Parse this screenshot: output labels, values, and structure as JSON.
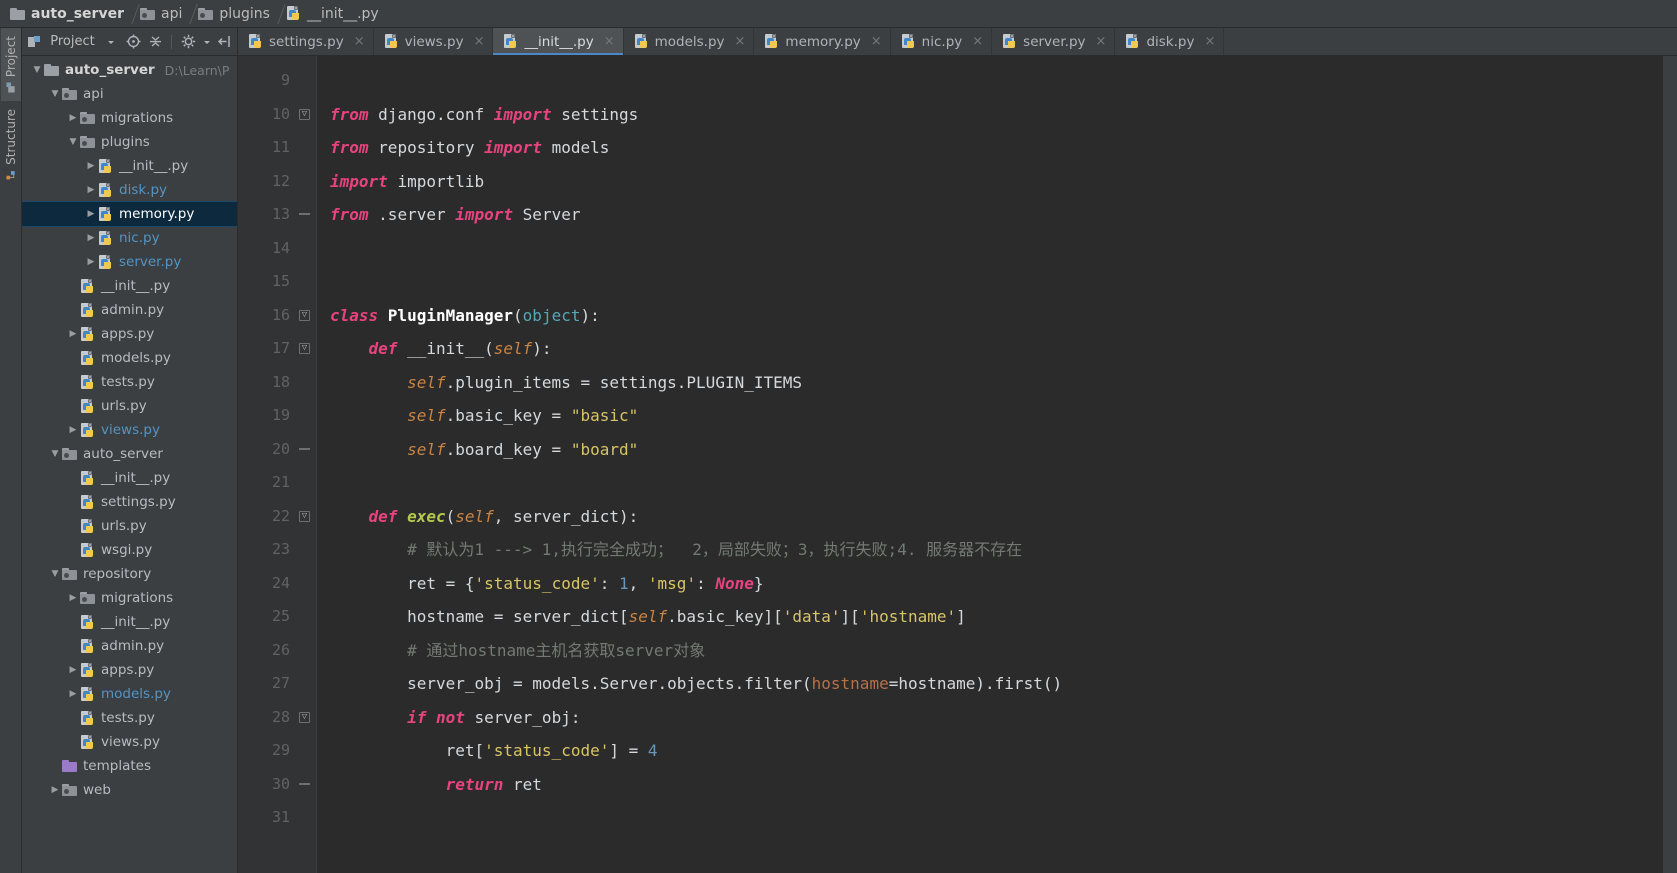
{
  "window": {
    "accent": "#4a88c7",
    "bg": "#3c3f41",
    "editor_bg": "#2b2b2b"
  },
  "breadcrumb": [
    {
      "label": "auto_server",
      "icon": "folder-icon",
      "bold": true
    },
    {
      "label": "api",
      "icon": "source-folder-icon",
      "bold": false
    },
    {
      "label": "plugins",
      "icon": "source-folder-icon",
      "bold": false
    },
    {
      "label": "__init__.py",
      "icon": "python-file-icon",
      "bold": false
    }
  ],
  "project_panel": {
    "title": "Project",
    "icons": {
      "panel": "project-panel-icon",
      "dropdown": "chevron-down-icon",
      "locate": "target-icon",
      "collapse": "collapse-all-icon",
      "settings": "gear-icon",
      "settings_arrow": "chevron-down-icon",
      "hide": "hide-panel-icon"
    },
    "tree": [
      {
        "depth": 0,
        "arrow": "down",
        "icon": "folder-icon",
        "label": "auto_server",
        "bold": true,
        "path": "D:\\Learn\\P",
        "selected": false,
        "color": "default"
      },
      {
        "depth": 1,
        "arrow": "down",
        "icon": "source-folder-icon",
        "label": "api",
        "bold": false,
        "path": "",
        "selected": false,
        "color": "default"
      },
      {
        "depth": 2,
        "arrow": "right",
        "icon": "source-folder-icon",
        "label": "migrations",
        "bold": false,
        "path": "",
        "selected": false,
        "color": "default"
      },
      {
        "depth": 2,
        "arrow": "down",
        "icon": "source-folder-icon",
        "label": "plugins",
        "bold": false,
        "path": "",
        "selected": false,
        "color": "default"
      },
      {
        "depth": 3,
        "arrow": "right",
        "icon": "python-file-icon",
        "label": "__init__.py",
        "bold": false,
        "path": "",
        "selected": false,
        "color": "default"
      },
      {
        "depth": 3,
        "arrow": "right",
        "icon": "python-file-icon",
        "label": "disk.py",
        "bold": false,
        "path": "",
        "selected": false,
        "color": "teal"
      },
      {
        "depth": 3,
        "arrow": "right",
        "icon": "python-file-icon",
        "label": "memory.py",
        "bold": false,
        "path": "",
        "selected": true,
        "color": "default"
      },
      {
        "depth": 3,
        "arrow": "right",
        "icon": "python-file-icon",
        "label": "nic.py",
        "bold": false,
        "path": "",
        "selected": false,
        "color": "teal"
      },
      {
        "depth": 3,
        "arrow": "right",
        "icon": "python-file-icon",
        "label": "server.py",
        "bold": false,
        "path": "",
        "selected": false,
        "color": "teal"
      },
      {
        "depth": 2,
        "arrow": "none",
        "icon": "python-file-icon",
        "label": "__init__.py",
        "bold": false,
        "path": "",
        "selected": false,
        "color": "default"
      },
      {
        "depth": 2,
        "arrow": "none",
        "icon": "python-file-icon",
        "label": "admin.py",
        "bold": false,
        "path": "",
        "selected": false,
        "color": "default"
      },
      {
        "depth": 2,
        "arrow": "right",
        "icon": "python-file-icon",
        "label": "apps.py",
        "bold": false,
        "path": "",
        "selected": false,
        "color": "default"
      },
      {
        "depth": 2,
        "arrow": "none",
        "icon": "python-file-icon",
        "label": "models.py",
        "bold": false,
        "path": "",
        "selected": false,
        "color": "default"
      },
      {
        "depth": 2,
        "arrow": "none",
        "icon": "python-file-icon",
        "label": "tests.py",
        "bold": false,
        "path": "",
        "selected": false,
        "color": "default"
      },
      {
        "depth": 2,
        "arrow": "none",
        "icon": "python-file-icon",
        "label": "urls.py",
        "bold": false,
        "path": "",
        "selected": false,
        "color": "default"
      },
      {
        "depth": 2,
        "arrow": "right",
        "icon": "python-file-icon",
        "label": "views.py",
        "bold": false,
        "path": "",
        "selected": false,
        "color": "teal"
      },
      {
        "depth": 1,
        "arrow": "down",
        "icon": "source-folder-icon",
        "label": "auto_server",
        "bold": false,
        "path": "",
        "selected": false,
        "color": "default"
      },
      {
        "depth": 2,
        "arrow": "none",
        "icon": "python-file-icon",
        "label": "__init__.py",
        "bold": false,
        "path": "",
        "selected": false,
        "color": "default"
      },
      {
        "depth": 2,
        "arrow": "none",
        "icon": "python-file-icon",
        "label": "settings.py",
        "bold": false,
        "path": "",
        "selected": false,
        "color": "default"
      },
      {
        "depth": 2,
        "arrow": "none",
        "icon": "python-file-icon",
        "label": "urls.py",
        "bold": false,
        "path": "",
        "selected": false,
        "color": "default"
      },
      {
        "depth": 2,
        "arrow": "none",
        "icon": "python-file-icon",
        "label": "wsgi.py",
        "bold": false,
        "path": "",
        "selected": false,
        "color": "default"
      },
      {
        "depth": 1,
        "arrow": "down",
        "icon": "source-folder-icon",
        "label": "repository",
        "bold": false,
        "path": "",
        "selected": false,
        "color": "default"
      },
      {
        "depth": 2,
        "arrow": "right",
        "icon": "source-folder-icon",
        "label": "migrations",
        "bold": false,
        "path": "",
        "selected": false,
        "color": "default"
      },
      {
        "depth": 2,
        "arrow": "none",
        "icon": "python-file-icon",
        "label": "__init__.py",
        "bold": false,
        "path": "",
        "selected": false,
        "color": "default"
      },
      {
        "depth": 2,
        "arrow": "none",
        "icon": "python-file-icon",
        "label": "admin.py",
        "bold": false,
        "path": "",
        "selected": false,
        "color": "default"
      },
      {
        "depth": 2,
        "arrow": "right",
        "icon": "python-file-icon",
        "label": "apps.py",
        "bold": false,
        "path": "",
        "selected": false,
        "color": "default"
      },
      {
        "depth": 2,
        "arrow": "right",
        "icon": "python-file-icon",
        "label": "models.py",
        "bold": false,
        "path": "",
        "selected": false,
        "color": "teal"
      },
      {
        "depth": 2,
        "arrow": "none",
        "icon": "python-file-icon",
        "label": "tests.py",
        "bold": false,
        "path": "",
        "selected": false,
        "color": "default"
      },
      {
        "depth": 2,
        "arrow": "none",
        "icon": "python-file-icon",
        "label": "views.py",
        "bold": false,
        "path": "",
        "selected": false,
        "color": "default"
      },
      {
        "depth": 1,
        "arrow": "none",
        "icon": "templates-folder-icon",
        "label": "templates",
        "bold": false,
        "path": "",
        "selected": false,
        "color": "default"
      },
      {
        "depth": 1,
        "arrow": "right",
        "icon": "source-folder-icon",
        "label": "web",
        "bold": false,
        "path": "",
        "selected": false,
        "color": "default"
      }
    ]
  },
  "tool_windows": [
    {
      "label": "Project",
      "icon": "project-icon",
      "selected": true
    },
    {
      "label": "Structure",
      "icon": "structure-icon",
      "selected": false
    }
  ],
  "editor_tabs": [
    {
      "label": "settings.py",
      "icon": "python-file-icon",
      "active": false,
      "close": "×"
    },
    {
      "label": "views.py",
      "icon": "python-file-icon",
      "active": false,
      "close": "×"
    },
    {
      "label": "__init__.py",
      "icon": "python-file-icon",
      "active": true,
      "close": "×"
    },
    {
      "label": "models.py",
      "icon": "python-file-icon",
      "active": false,
      "close": "×"
    },
    {
      "label": "memory.py",
      "icon": "python-file-icon",
      "active": false,
      "close": "×"
    },
    {
      "label": "nic.py",
      "icon": "python-file-icon",
      "active": false,
      "close": "×"
    },
    {
      "label": "server.py",
      "icon": "python-file-icon",
      "active": false,
      "close": "×"
    },
    {
      "label": "disk.py",
      "icon": "python-file-icon",
      "active": false,
      "close": "×"
    }
  ],
  "code": {
    "first_line_number": 9,
    "lines": [
      {
        "n": 9,
        "fold": "none",
        "tokens": []
      },
      {
        "n": 10,
        "fold": "start",
        "tokens": [
          {
            "t": "from ",
            "c": "kwpy"
          },
          {
            "t": "django.conf ",
            "c": "plain"
          },
          {
            "t": "import ",
            "c": "kwpy"
          },
          {
            "t": "settings",
            "c": "plain"
          }
        ]
      },
      {
        "n": 11,
        "fold": "none",
        "tokens": [
          {
            "t": "from ",
            "c": "kwpy"
          },
          {
            "t": "repository ",
            "c": "plain"
          },
          {
            "t": "import ",
            "c": "kwpy"
          },
          {
            "t": "models",
            "c": "plain"
          }
        ]
      },
      {
        "n": 12,
        "fold": "none",
        "tokens": [
          {
            "t": "import ",
            "c": "kwpy"
          },
          {
            "t": "importlib",
            "c": "plain"
          }
        ]
      },
      {
        "n": 13,
        "fold": "end",
        "tokens": [
          {
            "t": "from ",
            "c": "kwpy"
          },
          {
            "t": ".server ",
            "c": "plain"
          },
          {
            "t": "import ",
            "c": "kwpy"
          },
          {
            "t": "Server",
            "c": "plain"
          }
        ]
      },
      {
        "n": 14,
        "fold": "none",
        "tokens": []
      },
      {
        "n": 15,
        "fold": "none",
        "tokens": []
      },
      {
        "n": 16,
        "fold": "start",
        "tokens": [
          {
            "t": "class ",
            "c": "kwpy"
          },
          {
            "t": "PluginManager",
            "c": "cls"
          },
          {
            "t": "(",
            "c": "plain"
          },
          {
            "t": "object",
            "c": "bi"
          },
          {
            "t": "):",
            "c": "plain"
          }
        ]
      },
      {
        "n": 17,
        "fold": "start",
        "tokens": [
          {
            "t": "    ",
            "c": "plain"
          },
          {
            "t": "def ",
            "c": "kwpy"
          },
          {
            "t": "__init__",
            "c": "plain"
          },
          {
            "t": "(",
            "c": "plain"
          },
          {
            "t": "self",
            "c": "self"
          },
          {
            "t": "):",
            "c": "plain"
          }
        ]
      },
      {
        "n": 18,
        "fold": "none",
        "tokens": [
          {
            "t": "        ",
            "c": "plain"
          },
          {
            "t": "self",
            "c": "self"
          },
          {
            "t": ".plugin_items = settings.PLUGIN_ITEMS",
            "c": "plain"
          }
        ]
      },
      {
        "n": 19,
        "fold": "none",
        "tokens": [
          {
            "t": "        ",
            "c": "plain"
          },
          {
            "t": "self",
            "c": "self"
          },
          {
            "t": ".basic_key = ",
            "c": "plain"
          },
          {
            "t": "\"basic\"",
            "c": "str"
          }
        ]
      },
      {
        "n": 20,
        "fold": "end",
        "tokens": [
          {
            "t": "        ",
            "c": "plain"
          },
          {
            "t": "self",
            "c": "self"
          },
          {
            "t": ".board_key = ",
            "c": "plain"
          },
          {
            "t": "\"board\"",
            "c": "str"
          }
        ]
      },
      {
        "n": 21,
        "fold": "none",
        "tokens": []
      },
      {
        "n": 22,
        "fold": "start",
        "tokens": [
          {
            "t": "    ",
            "c": "plain"
          },
          {
            "t": "def ",
            "c": "kwpy"
          },
          {
            "t": "exec",
            "c": "fn"
          },
          {
            "t": "(",
            "c": "plain"
          },
          {
            "t": "self",
            "c": "self"
          },
          {
            "t": ", server_dict):",
            "c": "plain"
          }
        ]
      },
      {
        "n": 23,
        "fold": "none",
        "tokens": [
          {
            "t": "        # 默认为1 ---> 1,执行完全成功；  2，局部失败；3，执行失败;4. 服务器不存在",
            "c": "cmt"
          }
        ]
      },
      {
        "n": 24,
        "fold": "none",
        "tokens": [
          {
            "t": "        ret = {",
            "c": "plain"
          },
          {
            "t": "'status_code'",
            "c": "str"
          },
          {
            "t": ": ",
            "c": "plain"
          },
          {
            "t": "1",
            "c": "num"
          },
          {
            "t": ", ",
            "c": "plain"
          },
          {
            "t": "'msg'",
            "c": "str"
          },
          {
            "t": ": ",
            "c": "plain"
          },
          {
            "t": "None",
            "c": "none"
          },
          {
            "t": "}",
            "c": "plain"
          }
        ]
      },
      {
        "n": 25,
        "fold": "none",
        "tokens": [
          {
            "t": "        hostname = server_dict[",
            "c": "plain"
          },
          {
            "t": "self",
            "c": "self"
          },
          {
            "t": ".basic_key][",
            "c": "plain"
          },
          {
            "t": "'data'",
            "c": "str"
          },
          {
            "t": "][",
            "c": "plain"
          },
          {
            "t": "'hostname'",
            "c": "str"
          },
          {
            "t": "]",
            "c": "plain"
          }
        ]
      },
      {
        "n": 26,
        "fold": "none",
        "tokens": [
          {
            "t": "        # 通过hostname主机名获取server对象",
            "c": "cmt"
          }
        ]
      },
      {
        "n": 27,
        "fold": "none",
        "tokens": [
          {
            "t": "        server_obj = models.Server.objects.filter(",
            "c": "plain"
          },
          {
            "t": "hostname",
            "c": "kwarg"
          },
          {
            "t": "=hostname).first()",
            "c": "plain"
          }
        ]
      },
      {
        "n": 28,
        "fold": "start",
        "tokens": [
          {
            "t": "        ",
            "c": "plain"
          },
          {
            "t": "if not ",
            "c": "kwpy"
          },
          {
            "t": "server_obj:",
            "c": "plain"
          }
        ]
      },
      {
        "n": 29,
        "fold": "none",
        "tokens": [
          {
            "t": "            ret[",
            "c": "plain"
          },
          {
            "t": "'status_code'",
            "c": "str"
          },
          {
            "t": "] = ",
            "c": "plain"
          },
          {
            "t": "4",
            "c": "num"
          }
        ]
      },
      {
        "n": 30,
        "fold": "end",
        "tokens": [
          {
            "t": "            ",
            "c": "plain"
          },
          {
            "t": "return ",
            "c": "kwpy"
          },
          {
            "t": "ret",
            "c": "plain"
          }
        ]
      },
      {
        "n": 31,
        "fold": "none",
        "tokens": []
      }
    ]
  }
}
